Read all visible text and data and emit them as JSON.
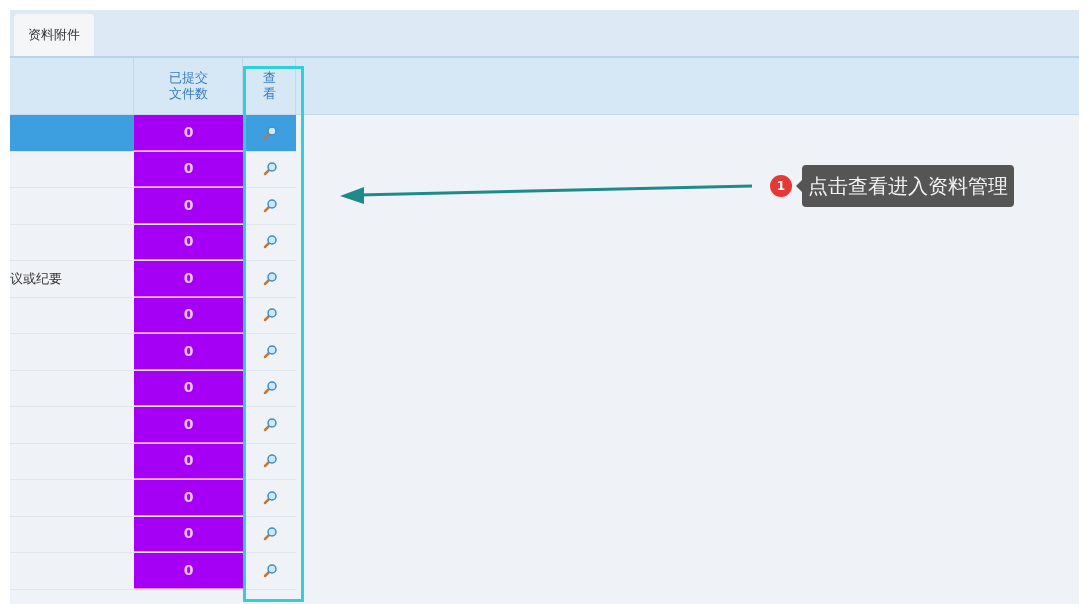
{
  "tabs": [
    {
      "label": "资料附件",
      "selected": true
    }
  ],
  "table": {
    "columns": [
      "已提交文件数",
      "查看"
    ],
    "rows": [
      {
        "count": "0",
        "selected": true
      },
      {
        "count": "0",
        "selected": false
      },
      {
        "count": "0",
        "selected": false
      },
      {
        "count": "0",
        "selected": false
      },
      {
        "name": "议或纪要",
        "count": "0",
        "selected": false
      },
      {
        "count": "0",
        "selected": false
      },
      {
        "count": "0",
        "selected": false
      },
      {
        "count": "0",
        "selected": false
      },
      {
        "count": "0",
        "selected": false
      },
      {
        "count": "0",
        "selected": false
      },
      {
        "count": "0",
        "selected": false
      },
      {
        "count": "0",
        "selected": false
      },
      {
        "count": "0",
        "selected": false
      }
    ]
  },
  "annotation": {
    "badge": "1",
    "text": "点击查看进入资料管理"
  }
}
